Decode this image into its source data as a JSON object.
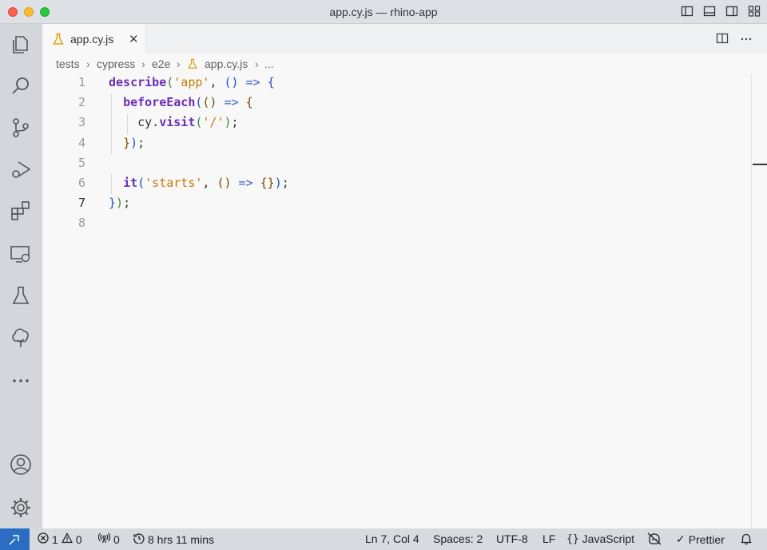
{
  "window": {
    "title": "app.cy.js — rhino-app"
  },
  "tab": {
    "label": "app.cy.js",
    "close": "✕"
  },
  "breadcrumb": {
    "items": [
      "tests",
      "cypress",
      "e2e",
      "app.cy.js",
      "..."
    ]
  },
  "editor": {
    "line_numbers": [
      "1",
      "2",
      "3",
      "4",
      "5",
      "6",
      "7",
      "8"
    ],
    "active_line": "7",
    "lines": [
      [
        {
          "t": "describe",
          "c": "kw"
        },
        {
          "t": "(",
          "c": "br1"
        },
        {
          "t": "'app'",
          "c": "str"
        },
        {
          "t": ", ",
          "c": "plain"
        },
        {
          "t": "()",
          "c": "br2"
        },
        {
          "t": " => ",
          "c": "op"
        },
        {
          "t": "{",
          "c": "br2"
        }
      ],
      [
        {
          "t": "  ",
          "c": "plain"
        },
        {
          "t": "beforeEach",
          "c": "kw"
        },
        {
          "t": "(",
          "c": "br2"
        },
        {
          "t": "()",
          "c": "br3"
        },
        {
          "t": " => ",
          "c": "op"
        },
        {
          "t": "{",
          "c": "br3"
        }
      ],
      [
        {
          "t": "    cy.",
          "c": "plain"
        },
        {
          "t": "visit",
          "c": "kw"
        },
        {
          "t": "(",
          "c": "br1"
        },
        {
          "t": "'/'",
          "c": "str"
        },
        {
          "t": ")",
          "c": "br1"
        },
        {
          "t": ";",
          "c": "plain"
        }
      ],
      [
        {
          "t": "  ",
          "c": "plain"
        },
        {
          "t": "}",
          "c": "br3"
        },
        {
          "t": ")",
          "c": "br2"
        },
        {
          "t": ";",
          "c": "plain"
        }
      ],
      [],
      [
        {
          "t": "  ",
          "c": "plain"
        },
        {
          "t": "it",
          "c": "kw"
        },
        {
          "t": "(",
          "c": "br2"
        },
        {
          "t": "'starts'",
          "c": "str"
        },
        {
          "t": ", ",
          "c": "plain"
        },
        {
          "t": "()",
          "c": "br3"
        },
        {
          "t": " => ",
          "c": "op"
        },
        {
          "t": "{}",
          "c": "br3"
        },
        {
          "t": ")",
          "c": "br2"
        },
        {
          "t": ";",
          "c": "plain"
        }
      ],
      [
        {
          "t": "}",
          "c": "br2"
        },
        {
          "t": ")",
          "c": "br1"
        },
        {
          "t": ";",
          "c": "plain"
        }
      ],
      []
    ]
  },
  "statusbar": {
    "errors": "1",
    "warnings": "0",
    "ports": "0",
    "time": "8 hrs 11 mins",
    "position": "Ln 7, Col 4",
    "spaces": "Spaces: 2",
    "encoding": "UTF-8",
    "eol": "LF",
    "language": "JavaScript",
    "prettier": "Prettier"
  },
  "colors": {
    "remote_accent": "#2c6dc4",
    "cypress_icon": "#e3a008"
  },
  "icons": [
    "explorer-icon",
    "search-icon",
    "source-control-icon",
    "run-debug-icon",
    "extensions-icon",
    "remote-explorer-icon",
    "testing-icon",
    "tree-icon",
    "more-icon",
    "account-icon",
    "settings-gear-icon"
  ]
}
